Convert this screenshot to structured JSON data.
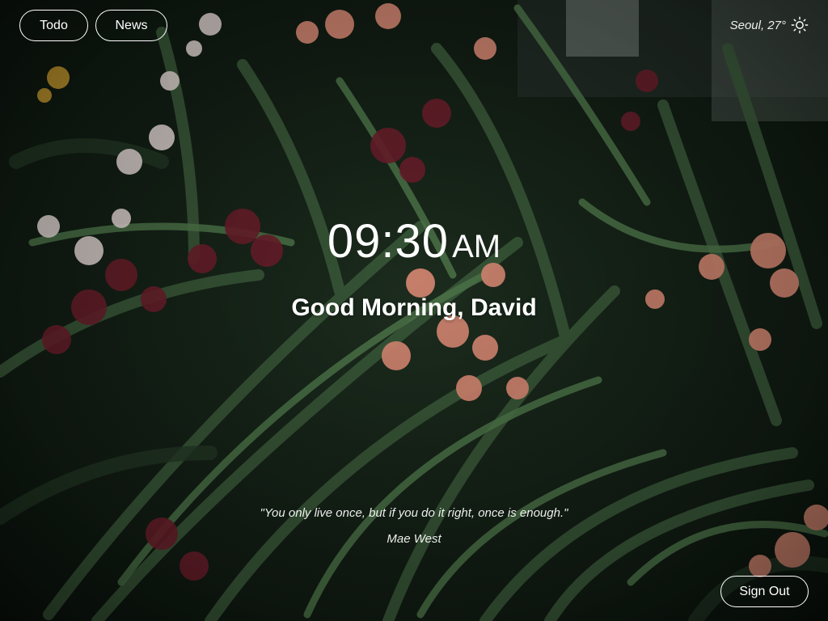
{
  "nav": {
    "todo_label": "Todo",
    "news_label": "News"
  },
  "weather": {
    "text": "Seoul, 27°",
    "icon": "sun-icon"
  },
  "clock": {
    "time": "09:30",
    "ampm": "AM"
  },
  "greeting": "Good Morning, David",
  "quote": {
    "text": "\"You only live once, but if you do it right, once is enough.\"",
    "author": "Mae West"
  },
  "account": {
    "sign_out_label": "Sign Out"
  },
  "colors": {
    "text": "#ffffff",
    "foliage": "#2f4a30",
    "flower_pink": "#d98a74",
    "flower_crimson": "#6e1f2c"
  }
}
